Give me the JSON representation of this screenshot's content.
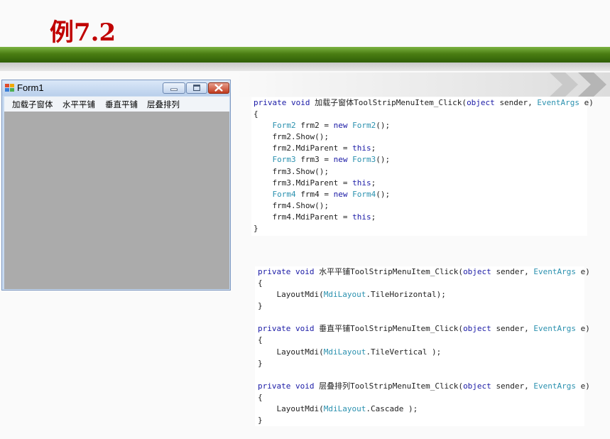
{
  "slide": {
    "title": "例7.2"
  },
  "colors": {
    "title": "#c00000",
    "band": "#4a7d12",
    "keyword": "#1a1aa6",
    "type": "#2b91af",
    "mdi_background": "#ababab"
  },
  "window": {
    "title": "Form1",
    "icons": {
      "app": "form-app-icon",
      "minimize": "minimize-icon",
      "maximize": "maximize-icon",
      "close": "close-icon"
    },
    "menu": [
      {
        "label": "加载子窗体"
      },
      {
        "label": "水平平铺"
      },
      {
        "label": "垂直平铺"
      },
      {
        "label": "层叠排列"
      }
    ]
  },
  "code1": {
    "l0": {
      "k1": "private",
      "k2": "void",
      "name": "加载子窗体ToolStripMenuItem_Click(",
      "k3": "object",
      "mid": "sender, ",
      "t1": "EventArgs",
      "end": "e)"
    },
    "l1": "{",
    "l2": {
      "t1": "Form2",
      "mid": "frm2 =",
      "k1": "new",
      "t2": "Form2",
      "end": "();"
    },
    "l3": "frm2.Show();",
    "l4": {
      "pre": "frm2.MdiParent =",
      "k1": "this",
      "end": ";"
    },
    "l5": {
      "t1": "Form3",
      "mid": "frm3 =",
      "k1": "new",
      "t2": "Form3",
      "end": "();"
    },
    "l6": "frm3.Show();",
    "l7": {
      "pre": "frm3.MdiParent =",
      "k1": "this",
      "end": ";"
    },
    "l8": {
      "t1": "Form4",
      "mid": "frm4 =",
      "k1": "new",
      "t2": "Form4",
      "end": "();"
    },
    "l9": "frm4.Show();",
    "l10": {
      "pre": "frm4.MdiParent =",
      "k1": "this",
      "end": ";"
    },
    "l11": "}"
  },
  "code2": {
    "m1": {
      "k1": "private",
      "k2": "void",
      "name": "水平平铺ToolStripMenuItem_Click(",
      "k3": "object",
      "mid": "sender, ",
      "t1": "EventArgs",
      "end": "e)",
      "open": "{",
      "pre": "LayoutMdi(",
      "t2": "MdiLayout",
      "arg": ".TileHorizontal);",
      "close": "}"
    },
    "m2": {
      "k1": "private",
      "k2": "void",
      "name": "垂直平铺ToolStripMenuItem_Click(",
      "k3": "object",
      "mid": "sender, ",
      "t1": "EventArgs",
      "end": "e)",
      "open": "{",
      "pre": "LayoutMdi(",
      "t2": "MdiLayout",
      "arg": ".TileVertical );",
      "close": "}"
    },
    "m3": {
      "k1": "private",
      "k2": "void",
      "name": "层叠排列ToolStripMenuItem_Click(",
      "k3": "object",
      "mid": "sender, ",
      "t1": "EventArgs",
      "end": "e)",
      "open": "{",
      "pre": "LayoutMdi(",
      "t2": "MdiLayout",
      "arg": ".Cascade );",
      "close": "}"
    }
  }
}
